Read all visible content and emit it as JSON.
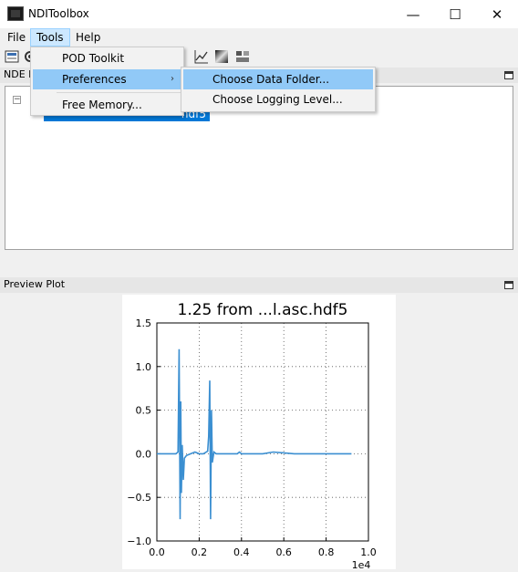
{
  "window": {
    "title": "NDIToolbox",
    "minimize_glyph": "—",
    "maximize_glyph": "☐",
    "close_glyph": "✕"
  },
  "menubar": {
    "file": "File",
    "tools": "Tools",
    "help": "Help"
  },
  "tools_menu": {
    "items": [
      {
        "label": "POD Toolkit"
      },
      {
        "label": "Preferences",
        "submenu_arrow": "›"
      },
      {
        "label": "Free Memory..."
      }
    ]
  },
  "preferences_submenu": {
    "items": [
      {
        "label": "Choose Data Folder..."
      },
      {
        "label": "Choose Logging Level..."
      }
    ]
  },
  "nde_panel": {
    "title": "NDE D",
    "expander_glyph": "−",
    "selected_file": "hdf5"
  },
  "preview_panel": {
    "title": "Preview Plot"
  },
  "icons": {
    "toolbar": [
      "open-icon",
      "gear-icon",
      "line-plot-icon",
      "image-plot-icon",
      "mega-plot-icon"
    ],
    "dock": [
      "float-icon"
    ]
  },
  "colors": {
    "selection": "#0078d7",
    "menu_highlight": "#91c9f7",
    "series": "#3b8fd1"
  },
  "chart_data": {
    "type": "line",
    "title": "1.25 from ...l.asc.hdf5",
    "xlabel": "",
    "ylabel": "",
    "x_offset_label": "1e4",
    "xlim": [
      0.0,
      1.0
    ],
    "ylim": [
      -1.0,
      1.5
    ],
    "x_ticks": [
      "0.0",
      "0.2",
      "0.4",
      "0.6",
      "0.8",
      "1.0"
    ],
    "y_ticks": [
      "1.5",
      "1.0",
      "0.5",
      "0.0",
      "−0.5",
      "−1.0"
    ],
    "grid": true,
    "series": [
      {
        "x": [
          0.0,
          0.05,
          0.09,
          0.1,
          0.105,
          0.11,
          0.113,
          0.116,
          0.12,
          0.125,
          0.13,
          0.14,
          0.16,
          0.18,
          0.2,
          0.22,
          0.24,
          0.245,
          0.25,
          0.254,
          0.258,
          0.262,
          0.27,
          0.28,
          0.3,
          0.38,
          0.39,
          0.4,
          0.5,
          0.55,
          0.6,
          0.65,
          0.7,
          0.8,
          0.9,
          0.92
        ],
        "y": [
          0.0,
          0.0,
          0.0,
          0.02,
          1.2,
          -0.75,
          0.6,
          -0.45,
          0.1,
          -0.3,
          -0.05,
          -0.02,
          0.0,
          0.02,
          0.0,
          0.0,
          0.03,
          0.2,
          0.84,
          -0.75,
          0.5,
          -0.1,
          0.02,
          0.0,
          0.0,
          0.0,
          0.02,
          0.0,
          0.0,
          0.02,
          0.01,
          0.0,
          0.0,
          0.0,
          0.0,
          0.0
        ]
      }
    ]
  }
}
